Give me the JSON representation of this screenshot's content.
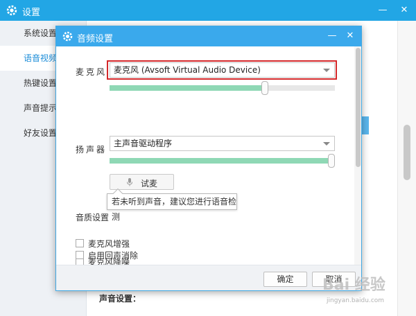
{
  "outer": {
    "title": "设置",
    "sidebar": [
      {
        "label": "系统设置"
      },
      {
        "label": "语音视频"
      },
      {
        "label": "热键设置"
      },
      {
        "label": "声音提示"
      },
      {
        "label": "好友设置"
      }
    ],
    "bottom_label": "声音设置："
  },
  "dialog": {
    "title": "音频设置",
    "mic": {
      "label": "麦克风",
      "selected": "麦克风 (Avsoft Virtual Audio Device)",
      "volume": 0.69
    },
    "speaker": {
      "label": "扬声器",
      "selected": "主声音驱动程序",
      "volume": 0.99
    },
    "test_button": "试麦",
    "tooltip": "若未听到声音，建议您进行语音检测",
    "quality_title": "音质设置",
    "options": [
      {
        "label": "麦克风增强"
      },
      {
        "label": "麦克风降噪"
      },
      {
        "label": "启用回声消除"
      }
    ],
    "ok": "确定",
    "cancel": "取消"
  },
  "watermark": {
    "main": "Bai 经验",
    "sub": "jingyan.baidu.com"
  },
  "colors": {
    "title_bar": "#22a6e5",
    "dialog_title": "#3aa9ec",
    "slider_fill": "#8fd8b5",
    "highlight": "#d4282a"
  }
}
